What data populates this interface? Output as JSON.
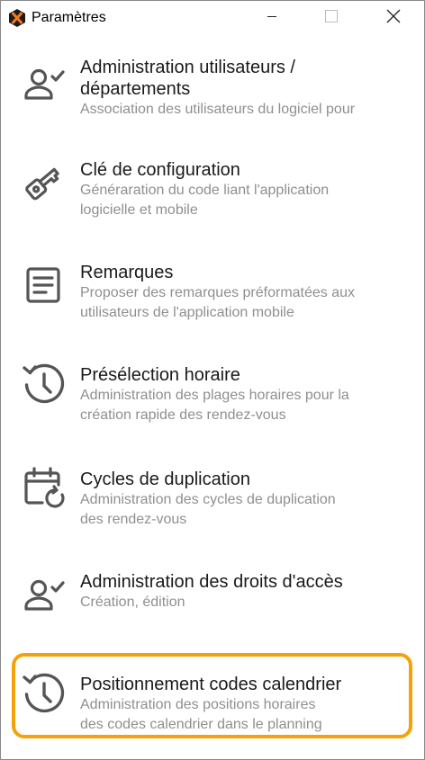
{
  "window": {
    "title": "Paramètres",
    "accent_color": "#f5a20a"
  },
  "controls": {
    "minimize_icon": "minimize-icon",
    "maximize_icon": "maximize-icon",
    "close_icon": "close-icon"
  },
  "items": [
    {
      "icon": "user-check-icon",
      "title_line1": "Administration utilisateurs /",
      "title_line2": "départements",
      "desc_line1": "Association des utilisateurs du logiciel pour",
      "desc_line2": ""
    },
    {
      "icon": "key-icon",
      "title_line1": "Clé de configuration",
      "title_line2": "",
      "desc_line1": "Généraration du code liant l'application",
      "desc_line2": "logicielle et mobile"
    },
    {
      "icon": "notes-icon",
      "title_line1": "Remarques",
      "title_line2": "",
      "desc_line1": "Proposer des remarques préformatées aux",
      "desc_line2": "utilisateurs de l'application mobile"
    },
    {
      "icon": "clock-history-icon",
      "title_line1": "Présélection horaire",
      "title_line2": "",
      "desc_line1": "Administration des plages horaires pour la",
      "desc_line2": "création rapide des rendez-vous"
    },
    {
      "icon": "calendar-refresh-icon",
      "title_line1": "Cycles de duplication",
      "title_line2": "",
      "desc_line1": "Administration des cycles de duplication",
      "desc_line2": "des rendez-vous"
    },
    {
      "icon": "user-check-icon",
      "title_line1": "Administration des droits d'accès",
      "title_line2": "",
      "desc_line1": "Création, édition",
      "desc_line2": ""
    },
    {
      "icon": "clock-history-icon",
      "title_line1": "Positionnement codes calendrier",
      "title_line2": "",
      "desc_line1": "Administration des positions horaires",
      "desc_line2": "des codes calendrier dans le planning",
      "highlighted": true
    }
  ]
}
